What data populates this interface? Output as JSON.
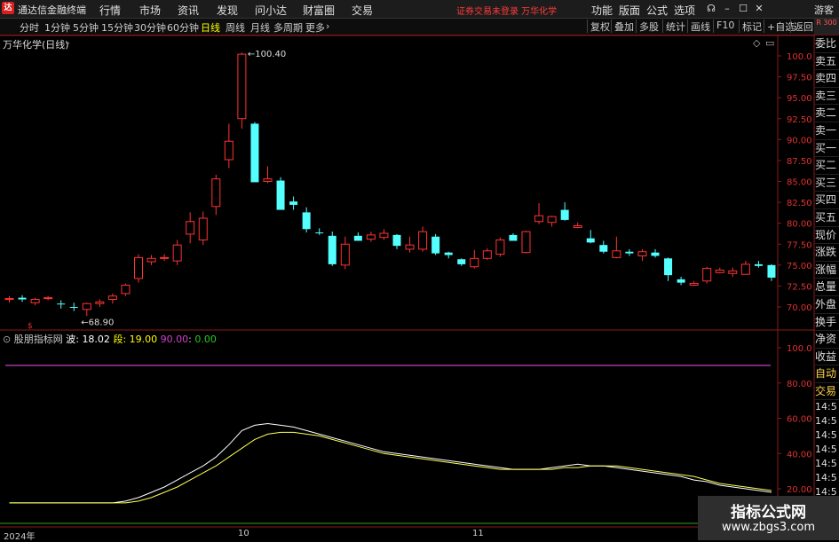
{
  "titlebar": {
    "app_name": "通达信金融终端",
    "menus": [
      "行情",
      "市场",
      "资讯",
      "发现",
      "问小达",
      "财富圈",
      "交易"
    ],
    "notice": "证券交易未登录  万华化学",
    "right_menus": [
      "功能",
      "版面",
      "公式",
      "选项"
    ],
    "guest": "游客"
  },
  "toolbar": {
    "periods": [
      "分时",
      "1分钟",
      "5分钟",
      "15分钟",
      "30分钟",
      "60分钟",
      "日线",
      "周线",
      "月线",
      "多周期",
      "更多"
    ],
    "active": "日线",
    "buttons": [
      "复权",
      "叠加",
      "多股",
      "统计",
      "画线",
      "F10",
      "标记",
      "+自选",
      "返回"
    ],
    "corner": "R 300"
  },
  "main_chart": {
    "title": "万华化学(日线)",
    "high_label": "100.40",
    "low_label": "68.90",
    "yticks": [
      "100.0",
      "97.50",
      "95.00",
      "92.50",
      "90.00",
      "87.50",
      "85.00",
      "82.50",
      "80.00",
      "77.50",
      "75.00",
      "72.50",
      "70.00"
    ],
    "up_color": "#ff3232",
    "down_color": "#54ffff"
  },
  "indicator": {
    "name": "股朋指标网",
    "wave_label": "波",
    "wave": "18.02",
    "seg_label": "段",
    "seg": "19.00",
    "line90": "90.00",
    "line0": "0.00",
    "yticks": [
      "100.0",
      "80.00",
      "60.00",
      "40.00",
      "20.00"
    ]
  },
  "right_panel": {
    "items": [
      "委比",
      "卖五",
      "卖四",
      "卖三",
      "卖二",
      "卖一",
      "买一",
      "买二",
      "买三",
      "买四",
      "买五",
      "现价",
      "涨跌",
      "涨幅",
      "总量",
      "外盘",
      "换手",
      "净资",
      "收益"
    ],
    "section": [
      "自动",
      "交易"
    ],
    "times": [
      "14:5",
      "14:5",
      "14:5",
      "14:5",
      "14:5",
      "14:5",
      "14:5",
      "14:5",
      "14:5",
      "14:5"
    ]
  },
  "timeaxis": [
    "2024年",
    "10",
    "11"
  ],
  "watermark": {
    "line1": "指标公式网",
    "line2": "www.zbgs3.com"
  },
  "chart_data": {
    "type": "candlestick",
    "candles": [
      [
        71.0,
        71.3,
        70.5,
        71.0
      ],
      [
        71.1,
        71.4,
        70.6,
        70.9
      ],
      [
        70.5,
        71.1,
        70.2,
        70.9
      ],
      [
        71.0,
        71.3,
        70.8,
        71.1
      ],
      [
        70.4,
        70.8,
        69.8,
        70.3
      ],
      [
        70.0,
        70.5,
        69.5,
        69.9
      ],
      [
        69.7,
        70.5,
        68.9,
        70.4
      ],
      [
        70.4,
        70.9,
        70.0,
        70.6
      ],
      [
        70.9,
        71.6,
        70.4,
        71.3
      ],
      [
        71.6,
        72.8,
        71.3,
        72.6
      ],
      [
        73.4,
        76.3,
        72.9,
        75.9
      ],
      [
        75.4,
        76.2,
        75.0,
        75.8
      ],
      [
        75.9,
        76.3,
        75.5,
        75.9
      ],
      [
        75.5,
        78.0,
        75.0,
        77.4
      ],
      [
        78.7,
        81.3,
        77.6,
        80.2
      ],
      [
        78.0,
        81.4,
        77.4,
        80.6
      ],
      [
        82.0,
        85.8,
        81.0,
        85.3
      ],
      [
        87.6,
        91.9,
        86.6,
        89.8
      ],
      [
        92.5,
        100.4,
        91.3,
        100.2
      ],
      [
        91.9,
        92.1,
        84.9,
        84.9
      ],
      [
        85.0,
        86.8,
        84.8,
        85.3
      ],
      [
        85.1,
        85.5,
        81.7,
        81.6
      ],
      [
        82.6,
        83.2,
        81.6,
        82.2
      ],
      [
        81.3,
        81.9,
        78.9,
        79.3
      ],
      [
        78.9,
        79.4,
        78.6,
        78.8
      ],
      [
        78.5,
        79.0,
        74.9,
        75.1
      ],
      [
        75.0,
        78.4,
        74.5,
        77.5
      ],
      [
        78.5,
        78.9,
        78.0,
        77.9
      ],
      [
        78.1,
        79.0,
        77.8,
        78.6
      ],
      [
        78.3,
        79.3,
        78.0,
        78.8
      ],
      [
        78.6,
        78.7,
        76.9,
        77.3
      ],
      [
        76.9,
        78.4,
        76.5,
        77.4
      ],
      [
        76.9,
        79.6,
        76.6,
        79.0
      ],
      [
        78.4,
        78.7,
        76.2,
        76.4
      ],
      [
        76.5,
        76.6,
        75.8,
        76.2
      ],
      [
        75.7,
        75.8,
        74.9,
        75.1
      ],
      [
        74.8,
        76.8,
        74.6,
        75.8
      ],
      [
        75.8,
        77.0,
        75.6,
        76.7
      ],
      [
        76.3,
        78.3,
        76.0,
        78.0
      ],
      [
        78.6,
        78.8,
        77.9,
        77.9
      ],
      [
        76.5,
        79.1,
        76.4,
        79.0
      ],
      [
        80.2,
        82.4,
        79.9,
        80.9
      ],
      [
        80.1,
        80.9,
        79.6,
        80.8
      ],
      [
        81.6,
        82.5,
        80.3,
        80.4
      ],
      [
        79.5,
        80.1,
        79.4,
        79.7
      ],
      [
        78.2,
        79.2,
        77.6,
        77.7
      ],
      [
        77.4,
        77.9,
        76.4,
        76.6
      ],
      [
        75.9,
        78.4,
        75.8,
        76.7
      ],
      [
        76.6,
        76.9,
        76.1,
        76.4
      ],
      [
        76.1,
        76.9,
        75.5,
        76.6
      ],
      [
        76.5,
        76.9,
        75.9,
        76.1
      ],
      [
        75.8,
        75.9,
        73.1,
        73.8
      ],
      [
        73.3,
        73.6,
        72.6,
        72.9
      ],
      [
        72.6,
        73.1,
        72.5,
        72.8
      ],
      [
        73.1,
        74.8,
        72.8,
        74.6
      ],
      [
        74.1,
        74.7,
        74.0,
        74.4
      ],
      [
        74.0,
        74.7,
        73.6,
        74.3
      ],
      [
        73.9,
        75.5,
        73.9,
        75.1
      ],
      [
        75.1,
        75.5,
        74.7,
        74.9
      ],
      [
        75.0,
        75.1,
        73.1,
        73.5
      ]
    ],
    "wave": [
      12,
      12,
      12,
      12,
      12,
      12,
      12,
      12,
      12,
      13,
      15,
      18,
      21,
      25,
      29,
      33,
      38,
      45,
      53,
      56,
      57,
      56,
      55,
      53,
      51,
      49,
      47,
      45,
      43,
      41,
      40,
      39,
      38,
      37,
      36,
      35,
      34,
      33,
      32,
      31,
      31,
      31,
      32,
      33,
      34,
      33,
      33,
      32,
      31,
      30,
      29,
      28,
      27,
      25,
      24,
      22,
      21,
      20,
      19,
      18
    ],
    "seg": [
      12,
      12,
      12,
      12,
      12,
      12,
      12,
      12,
      12,
      12,
      13,
      15,
      18,
      21,
      25,
      29,
      33,
      38,
      43,
      48,
      51,
      52,
      52,
      51,
      50,
      48,
      46,
      44,
      42,
      40,
      39,
      38,
      37,
      36,
      35,
      34,
      33,
      32,
      31,
      31,
      31,
      31,
      31,
      32,
      32,
      33,
      33,
      33,
      32,
      31,
      30,
      29,
      28,
      27,
      25,
      23,
      22,
      21,
      20,
      19
    ],
    "ylim": [
      68,
      101
    ],
    "ind_ylim": [
      10,
      100
    ]
  }
}
